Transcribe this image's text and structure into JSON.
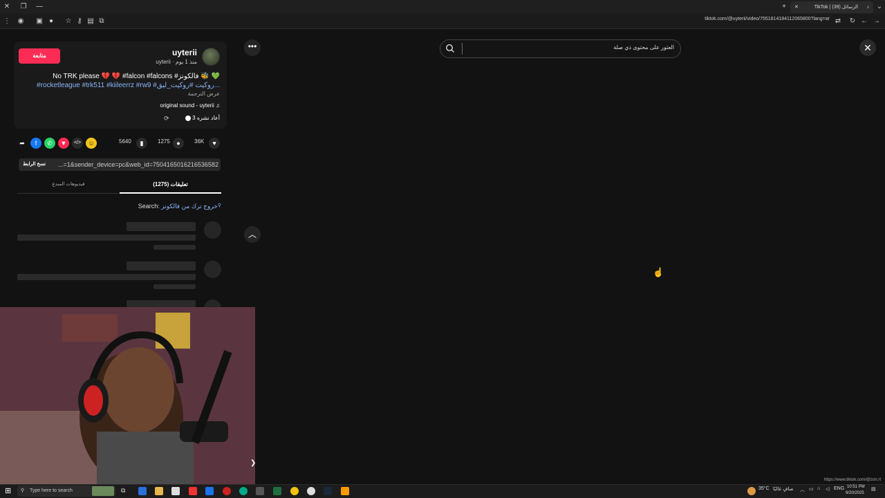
{
  "browser": {
    "tab_title": "TikTok | الرسائل (39)",
    "url": "tiktok.com/@uyterii/video/7551814184112065800?lang=ar"
  },
  "video": {
    "username": "uyterii",
    "subline": "uyterii · منذ 1 يوم",
    "follow_label": "متابعة",
    "caption_line1": "No TRK please 💔 💔 #falcon #falcons #فالكونز 🐝 💚",
    "caption_line2": "#rocketleague #trk511 #kiileerrz #rw9 #روكيت #روكيت_ليق...",
    "translate_label": "عرض الترجمة",
    "sound": "original sound - uyterii ♫",
    "reposts": "3 أعاد نشره"
  },
  "stats": {
    "likes": "36K",
    "comments": "1275",
    "saves": "5640"
  },
  "share": {
    "copy_link_label": "نسخ الرابط",
    "link_text": "...=1&sender_device=pc&web_id=7504165016216536582"
  },
  "tabs": {
    "comments": "تعليقات (1275)",
    "creator_videos": "فيديوهات المبدع"
  },
  "search_suggest": {
    "prefix": "Search:",
    "query": "خروج ترك من فالكونز"
  },
  "top_search": {
    "placeholder": "العثور على محتوى ذي صلة"
  },
  "taskbar": {
    "search_placeholder": "Type here to search",
    "weather": "35°C",
    "weather_text": "صافٍ غالبًا",
    "lang": "ENG",
    "time": "10:51 PM",
    "date": "9/20/2025"
  },
  "status_bar_url": "https://www.tiktok.com/@zon.rt"
}
